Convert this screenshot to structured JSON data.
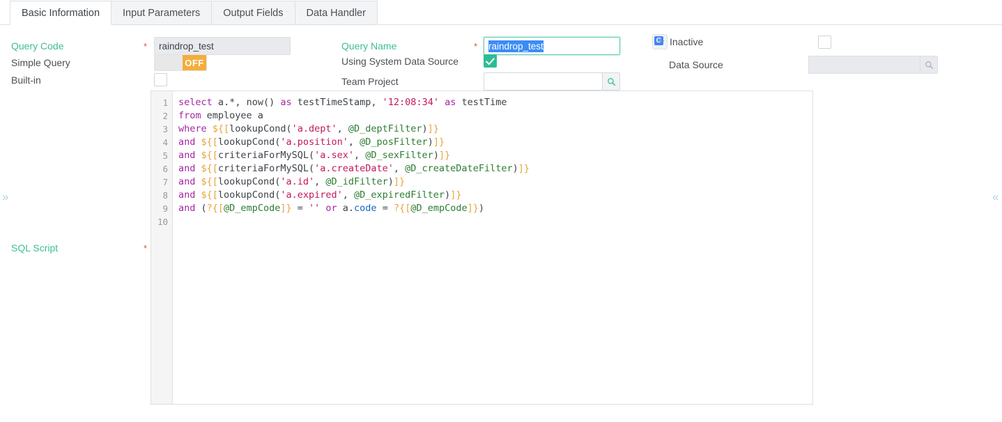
{
  "tabs": [
    {
      "label": "Basic Information",
      "active": true
    },
    {
      "label": "Input Parameters",
      "active": false
    },
    {
      "label": "Output Fields",
      "active": false
    },
    {
      "label": "Data Handler",
      "active": false
    }
  ],
  "form": {
    "query_code": {
      "label": "Query Code",
      "required": "*",
      "value": "raindrop_test",
      "placeholder": ""
    },
    "simple_query": {
      "label": "Simple Query",
      "state": "OFF"
    },
    "built_in": {
      "label": "Built-in",
      "checked": false
    },
    "query_name": {
      "label": "Query Name",
      "required": "*",
      "value": "raindrop_test",
      "selected": true
    },
    "using_system_data_source": {
      "label": "Using System Data Source",
      "checked": true
    },
    "team_project": {
      "label": "Team Project",
      "value": "",
      "placeholder": "",
      "search_icon": "search-icon"
    },
    "inactive": {
      "label": "Inactive",
      "checked": false,
      "ext_icon": "google-translate-icon"
    },
    "data_source": {
      "label": "Data Source",
      "value": "",
      "placeholder": "",
      "disabled": true,
      "search_icon": "search-icon"
    },
    "sql_script": {
      "label": "SQL Script",
      "required": "*"
    }
  },
  "editor": {
    "line_numbers": [
      "1",
      "2",
      "3",
      "4",
      "5",
      "6",
      "7",
      "8",
      "9",
      "10"
    ],
    "lines": [
      [
        {
          "t": "select",
          "c": "k"
        },
        {
          "t": " ",
          "c": "op"
        },
        {
          "t": "a.*",
          "c": "fn"
        },
        {
          "t": ", ",
          "c": "op"
        },
        {
          "t": "now",
          "c": "fn"
        },
        {
          "t": "() ",
          "c": "op"
        },
        {
          "t": "as",
          "c": "k"
        },
        {
          "t": " testTimeStamp, ",
          "c": "fn"
        },
        {
          "t": "'12:08:34'",
          "c": "st"
        },
        {
          "t": " ",
          "c": "op"
        },
        {
          "t": "as",
          "c": "k"
        },
        {
          "t": " testTime",
          "c": "fn"
        }
      ],
      [
        {
          "t": "from",
          "c": "k"
        },
        {
          "t": " employee a",
          "c": "fn"
        }
      ],
      [
        {
          "t": "where",
          "c": "k"
        },
        {
          "t": " ",
          "c": "op"
        },
        {
          "t": "${[",
          "c": "br"
        },
        {
          "t": "lookupCond(",
          "c": "fn"
        },
        {
          "t": "'a.dept'",
          "c": "st"
        },
        {
          "t": ", ",
          "c": "op"
        },
        {
          "t": "@D_deptFilter",
          "c": "var"
        },
        {
          "t": ")",
          "c": "fn"
        },
        {
          "t": "]}",
          "c": "br"
        }
      ],
      [
        {
          "t": "and",
          "c": "k"
        },
        {
          "t": " ",
          "c": "op"
        },
        {
          "t": "${[",
          "c": "br"
        },
        {
          "t": "lookupCond(",
          "c": "fn"
        },
        {
          "t": "'a.position'",
          "c": "st"
        },
        {
          "t": ", ",
          "c": "op"
        },
        {
          "t": "@D_posFilter",
          "c": "var"
        },
        {
          "t": ")",
          "c": "fn"
        },
        {
          "t": "]}",
          "c": "br"
        }
      ],
      [
        {
          "t": "and",
          "c": "k"
        },
        {
          "t": " ",
          "c": "op"
        },
        {
          "t": "${[",
          "c": "br"
        },
        {
          "t": "criteriaForMySQL(",
          "c": "fn"
        },
        {
          "t": "'a.sex'",
          "c": "st"
        },
        {
          "t": ", ",
          "c": "op"
        },
        {
          "t": "@D_sexFilter",
          "c": "var"
        },
        {
          "t": ")",
          "c": "fn"
        },
        {
          "t": "]}",
          "c": "br"
        }
      ],
      [
        {
          "t": "and",
          "c": "k"
        },
        {
          "t": " ",
          "c": "op"
        },
        {
          "t": "${[",
          "c": "br"
        },
        {
          "t": "criteriaForMySQL(",
          "c": "fn"
        },
        {
          "t": "'a.createDate'",
          "c": "st"
        },
        {
          "t": ", ",
          "c": "op"
        },
        {
          "t": "@D_createDateFilter",
          "c": "var"
        },
        {
          "t": ")",
          "c": "fn"
        },
        {
          "t": "]}",
          "c": "br"
        }
      ],
      [
        {
          "t": "and",
          "c": "k"
        },
        {
          "t": " ",
          "c": "op"
        },
        {
          "t": "${[",
          "c": "br"
        },
        {
          "t": "lookupCond(",
          "c": "fn"
        },
        {
          "t": "'a.id'",
          "c": "st"
        },
        {
          "t": ", ",
          "c": "op"
        },
        {
          "t": "@D_idFilter",
          "c": "var"
        },
        {
          "t": ")",
          "c": "fn"
        },
        {
          "t": "]}",
          "c": "br"
        }
      ],
      [
        {
          "t": "and",
          "c": "k"
        },
        {
          "t": " ",
          "c": "op"
        },
        {
          "t": "${[",
          "c": "br"
        },
        {
          "t": "lookupCond(",
          "c": "fn"
        },
        {
          "t": "'a.expired'",
          "c": "st"
        },
        {
          "t": ", ",
          "c": "op"
        },
        {
          "t": "@D_expiredFilter",
          "c": "var"
        },
        {
          "t": ")",
          "c": "fn"
        },
        {
          "t": "]}",
          "c": "br"
        }
      ],
      [
        {
          "t": "and",
          "c": "k"
        },
        {
          "t": " (",
          "c": "op"
        },
        {
          "t": "?{[",
          "c": "br"
        },
        {
          "t": "@D_empCode",
          "c": "var"
        },
        {
          "t": "]}",
          "c": "br"
        },
        {
          "t": " = ",
          "c": "op"
        },
        {
          "t": "''",
          "c": "st"
        },
        {
          "t": " ",
          "c": "op"
        },
        {
          "t": "or",
          "c": "k"
        },
        {
          "t": " a.",
          "c": "op"
        },
        {
          "t": "code",
          "c": "cyan"
        },
        {
          "t": " = ",
          "c": "op"
        },
        {
          "t": "?{[",
          "c": "br"
        },
        {
          "t": "@D_empCode",
          "c": "var"
        },
        {
          "t": "]}",
          "c": "br"
        },
        {
          "t": ")",
          "c": "op"
        }
      ],
      []
    ]
  },
  "panel_toggles": {
    "left": "»",
    "right": "«"
  },
  "colors": {
    "accent_teal": "#3dbd96",
    "required_red": "#e8503a",
    "toggle_off_orange": "#f3ae3d",
    "checkbox_checked": "#2ebd93",
    "selection_blue": "#3b8cf5",
    "border_grey": "#dcdfe3"
  }
}
